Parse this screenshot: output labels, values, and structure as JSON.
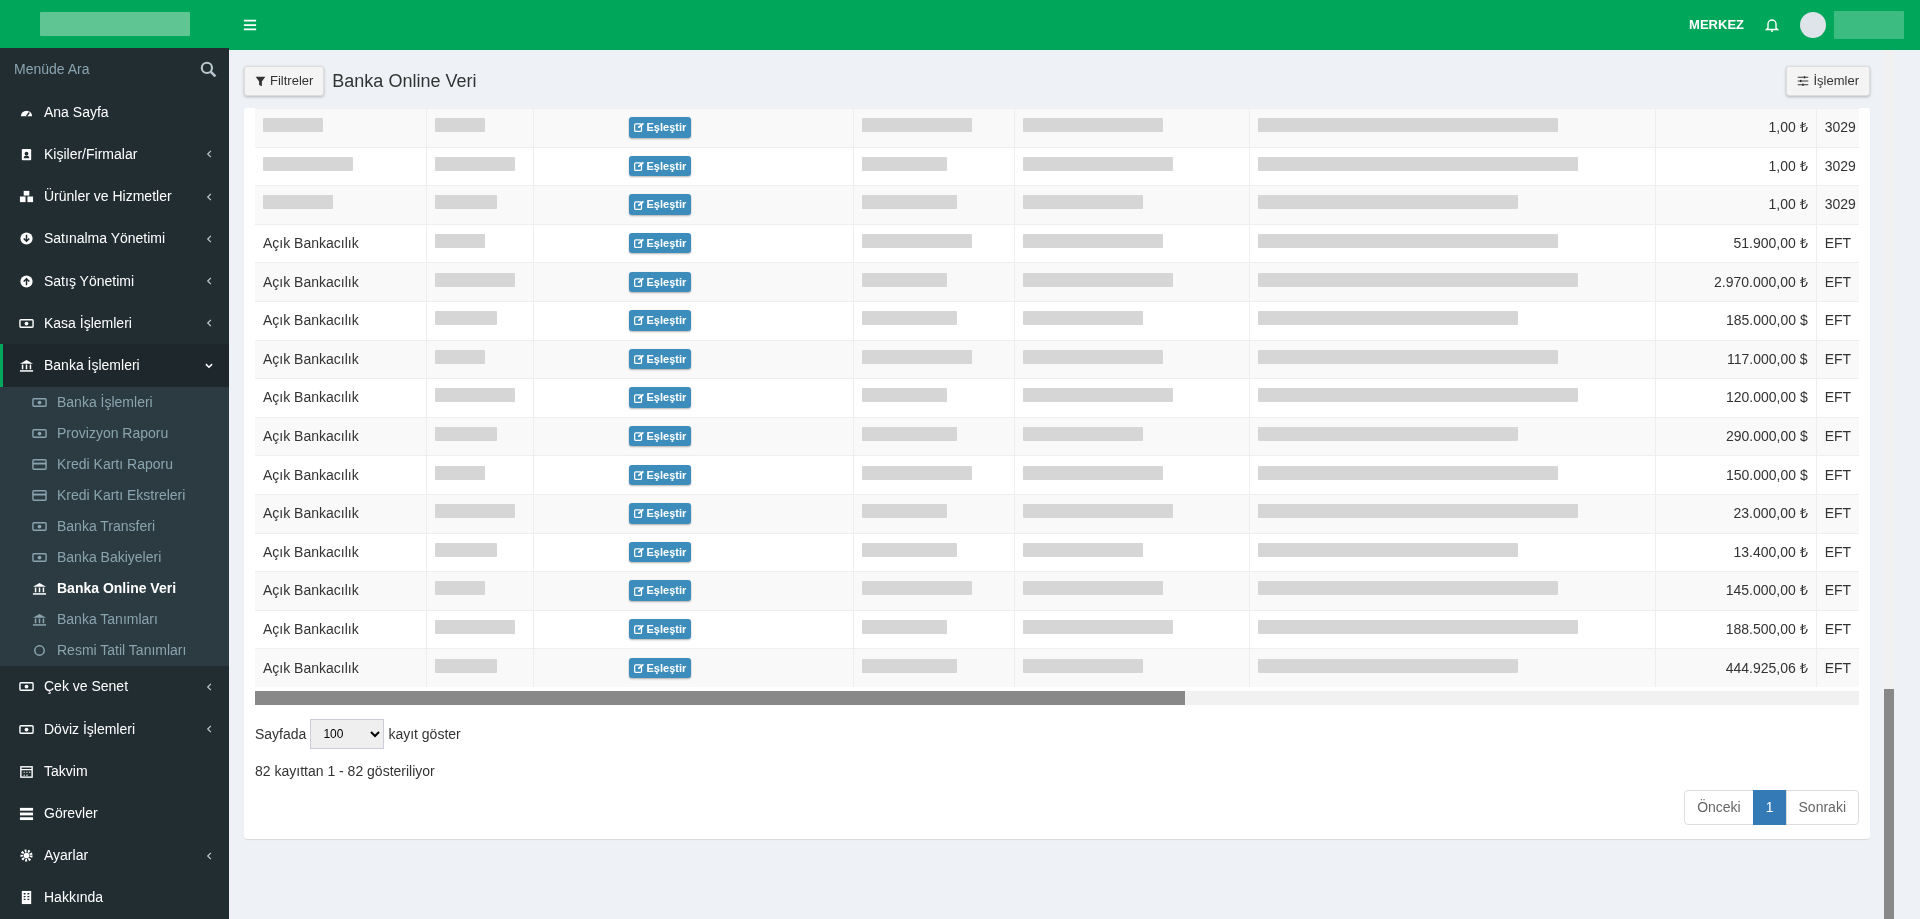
{
  "topbar": {
    "branch": "MERKEZ"
  },
  "sidebar": {
    "search_placeholder": "Menüde Ara",
    "items": [
      {
        "label": "Ana Sayfa",
        "selected": false
      },
      {
        "label": "Kişiler/Firmalar",
        "expanded": false,
        "selected": false
      },
      {
        "label": "Ürünler ve Hizmetler",
        "expanded": false,
        "selected": false
      },
      {
        "label": "Satınalma Yönetimi",
        "expanded": false,
        "selected": false
      },
      {
        "label": "Satış Yönetimi",
        "expanded": false,
        "selected": false
      },
      {
        "label": "Kasa İşlemleri",
        "expanded": false,
        "selected": false
      },
      {
        "label": "Banka İşlemleri",
        "expanded": true,
        "selected": true,
        "children": [
          {
            "label": "Banka İşlemleri",
            "selected": false
          },
          {
            "label": "Provizyon Raporu",
            "selected": false
          },
          {
            "label": "Kredi Kartı Raporu",
            "selected": false
          },
          {
            "label": "Kredi Kartı Ekstreleri",
            "selected": false
          },
          {
            "label": "Banka Transferi",
            "selected": false
          },
          {
            "label": "Banka Bakiyeleri",
            "selected": false
          },
          {
            "label": "Banka Online Veri",
            "selected": true
          },
          {
            "label": "Banka Tanımları",
            "selected": false
          },
          {
            "label": "Resmi Tatil Tanımları",
            "selected": false
          }
        ]
      },
      {
        "label": "Çek ve Senet",
        "expanded": false,
        "selected": false
      },
      {
        "label": "Döviz İşlemleri",
        "expanded": false,
        "selected": false
      },
      {
        "label": "Takvim",
        "selected": false
      },
      {
        "label": "Görevler",
        "selected": false
      },
      {
        "label": "Ayarlar",
        "expanded": false,
        "selected": false
      },
      {
        "label": "Hakkında",
        "selected": false
      }
    ]
  },
  "toolbar": {
    "filter_button": "Filtreler",
    "title": "Banka Online Veri",
    "actions_button": "İşlemler"
  },
  "table": {
    "rows": [
      {
        "action": "Eşleştir",
        "amount": "1,00 ₺",
        "code": "3029"
      },
      {
        "action": "Eşleştir",
        "amount": "1,00 ₺",
        "code": "3029"
      },
      {
        "action": "Eşleştir",
        "amount": "1,00 ₺",
        "code": "3029"
      },
      {
        "type": "Açık Bankacılık",
        "action": "Eşleştir",
        "amount": "51.900,00 ₺",
        "code": "EFT"
      },
      {
        "type": "Açık Bankacılık",
        "action": "Eşleştir",
        "amount": "2.970.000,00 ₺",
        "code": "EFT"
      },
      {
        "type": "Açık Bankacılık",
        "action": "Eşleştir",
        "amount": "185.000,00 $",
        "code": "EFT"
      },
      {
        "type": "Açık Bankacılık",
        "action": "Eşleştir",
        "amount": "117.000,00 $",
        "code": "EFT"
      },
      {
        "type": "Açık Bankacılık",
        "action": "Eşleştir",
        "amount": "120.000,00 $",
        "code": "EFT"
      },
      {
        "type": "Açık Bankacılık",
        "action": "Eşleştir",
        "amount": "290.000,00 $",
        "code": "EFT"
      },
      {
        "type": "Açık Bankacılık",
        "action": "Eşleştir",
        "amount": "150.000,00 $",
        "code": "EFT"
      },
      {
        "type": "Açık Bankacılık",
        "action": "Eşleştir",
        "amount": "23.000,00 ₺",
        "code": "EFT"
      },
      {
        "type": "Açık Bankacılık",
        "action": "Eşleştir",
        "amount": "13.400,00 ₺",
        "code": "EFT"
      },
      {
        "type": "Açık Bankacılık",
        "action": "Eşleştir",
        "amount": "145.000,00 ₺",
        "code": "EFT"
      },
      {
        "type": "Açık Bankacılık",
        "action": "Eşleştir",
        "amount": "188.500,00 ₺",
        "code": "EFT"
      },
      {
        "type": "Açık Bankacılık",
        "action": "Eşleştir",
        "amount": "444.925,06 ₺",
        "code": "EFT"
      }
    ]
  },
  "page_size": {
    "prefix": "Sayfada",
    "value": "100",
    "suffix": "kayıt göster"
  },
  "info": "82 kayıttan 1 - 82 gösteriliyor",
  "pagination": [
    {
      "label": "Önceki",
      "selected": false
    },
    {
      "label": "1",
      "selected": true
    },
    {
      "label": "Sonraki",
      "selected": false
    }
  ]
}
